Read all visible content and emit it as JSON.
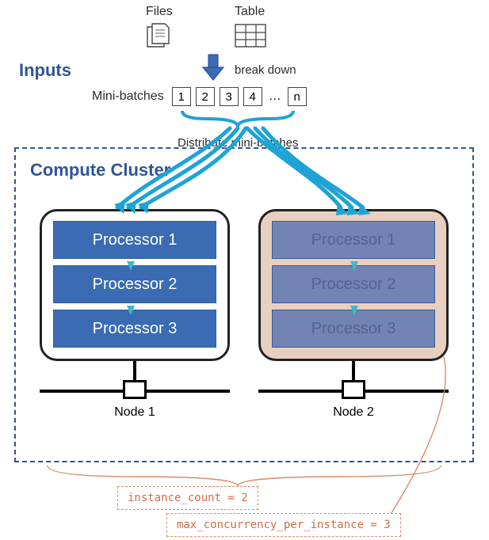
{
  "headings": {
    "inputs": "Inputs",
    "compute_cluster": "Compute Cluster"
  },
  "labels": {
    "files": "Files",
    "table": "Table",
    "break_down": "break down",
    "mini_batches": "Mini-batches",
    "distribute": "Distribute mini-batches",
    "node1": "Node 1",
    "node2": "Node 2"
  },
  "mini_batches": {
    "shown": [
      "1",
      "2",
      "3",
      "4"
    ],
    "ellipsis": "…",
    "last": "n"
  },
  "processors": {
    "p1": "Processor 1",
    "p2": "Processor 2",
    "p3": "Processor 3"
  },
  "annotations": {
    "instance_count": "instance_count = 2",
    "max_conc": "max_concurrency_per_instance = 3"
  }
}
